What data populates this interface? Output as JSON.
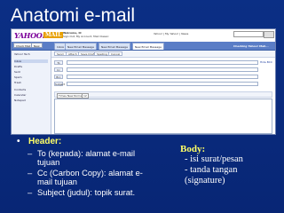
{
  "slide": {
    "title": "Anatomi e-mail"
  },
  "screenshot": {
    "logo": "YAHOO!",
    "logo_mail": "MAIL",
    "welcome_user": "Welcome, lil",
    "welcome_links": "Sign Out, My Account, Mail Classic",
    "header_links": "Yahoo! | My Yahoo! | News",
    "buttons": {
      "check_mail": "Check Mail",
      "new": "New"
    },
    "tabs": [
      "Inbox",
      "New Email Message",
      "New Email Message",
      "New Email Message"
    ],
    "tab_status": "Checking Yahoo! Mail...",
    "sidebar": [
      "Yahoo! Tech",
      "Inbox",
      "Drafts",
      "Sent",
      "Spam",
      "Trash",
      "Contacts",
      "Calendar",
      "Notepad"
    ],
    "toolbar": [
      "Send",
      "Attach",
      "Save Draft",
      "Spelling",
      "Cancel"
    ],
    "fields": [
      {
        "label": "To",
        "link": "Hide BCC"
      },
      {
        "label": "Cc",
        "link": ""
      },
      {
        "label": "Bcc",
        "link": ""
      },
      {
        "label": "Subject",
        "link": ""
      }
    ],
    "format": {
      "font": "Times New Roman",
      "size": "12"
    }
  },
  "header_section": {
    "heading": "Header:",
    "items": [
      "To (kepada): alamat e-mail tujuan",
      "Cc (Carbon Copy): alamat e-mail tujuan",
      "Subject (judul): topik surat."
    ]
  },
  "body_section": {
    "heading": "Body:",
    "items": [
      "- isi surat/pesan",
      "- tanda tangan",
      "(signature)"
    ]
  }
}
